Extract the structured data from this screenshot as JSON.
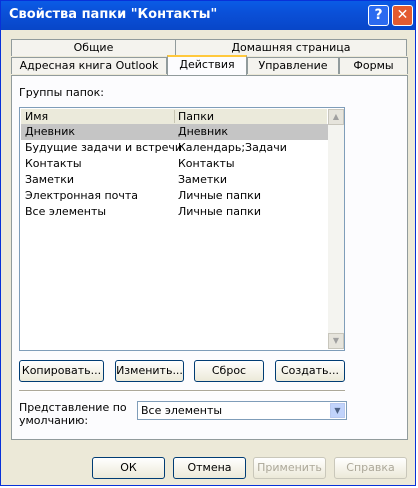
{
  "window": {
    "title": "Свойства папки \"Контакты\""
  },
  "titlebar": {
    "help_glyph": "?",
    "close_glyph": "✕"
  },
  "tabs": {
    "row1": [
      "Общие",
      "Домашняя страница"
    ],
    "row2": [
      "Адресная книга Outlook",
      "Действия",
      "Управление",
      "Формы"
    ],
    "active": "Действия"
  },
  "groups_label": "Группы папок:",
  "list": {
    "columns": [
      "Имя",
      "Папки"
    ],
    "rows": [
      [
        "Дневник",
        "Дневник"
      ],
      [
        "Будущие задачи и встречи",
        "Календарь;Задачи"
      ],
      [
        "Контакты",
        "Контакты"
      ],
      [
        "Заметки",
        "Заметки"
      ],
      [
        "Электронная почта",
        "Личные папки"
      ],
      [
        "Все элементы",
        "Личные папки"
      ]
    ],
    "selected_index": 0
  },
  "actions": {
    "copy": "Копировать...",
    "edit": "Изменить...",
    "reset": "Сброс",
    "create": "Создать..."
  },
  "default_view": {
    "label_line1": "Представление по",
    "label_line2": "умолчанию:",
    "value": "Все элементы"
  },
  "footer": {
    "ok": "ОК",
    "cancel": "Отмена",
    "apply": "Применить",
    "help": "Справка"
  }
}
